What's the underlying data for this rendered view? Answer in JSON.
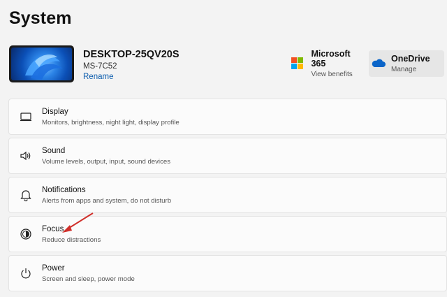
{
  "page": {
    "title": "System"
  },
  "device": {
    "name": "DESKTOP-25QV20S",
    "model": "MS-7C52",
    "rename_label": "Rename",
    "thumbnail_icon": "windows-bloom-wallpaper"
  },
  "header_cards": {
    "ms365": {
      "title": "Microsoft 365",
      "subtitle": "View benefits",
      "icon": "microsoft-logo-icon"
    },
    "onedrive": {
      "title": "OneDrive",
      "subtitle": "Manage",
      "icon": "cloud-icon"
    }
  },
  "settings": [
    {
      "title": "Display",
      "desc": "Monitors, brightness, night light, display profile",
      "icon": "monitor-icon"
    },
    {
      "title": "Sound",
      "desc": "Volume levels, output, input, sound devices",
      "icon": "speaker-icon"
    },
    {
      "title": "Notifications",
      "desc": "Alerts from apps and system, do not disturb",
      "icon": "bell-icon"
    },
    {
      "title": "Focus",
      "desc": "Reduce distractions",
      "icon": "focus-icon"
    },
    {
      "title": "Power",
      "desc": "Screen and sleep, power mode",
      "icon": "power-icon"
    }
  ],
  "colors": {
    "accent_link": "#0b5cad",
    "annotation_arrow": "#d0302b",
    "ms_red": "#f25022",
    "ms_green": "#7fba00",
    "ms_blue": "#00a4ef",
    "ms_yellow": "#ffb900",
    "onedrive_blue": "#0a64c8"
  }
}
